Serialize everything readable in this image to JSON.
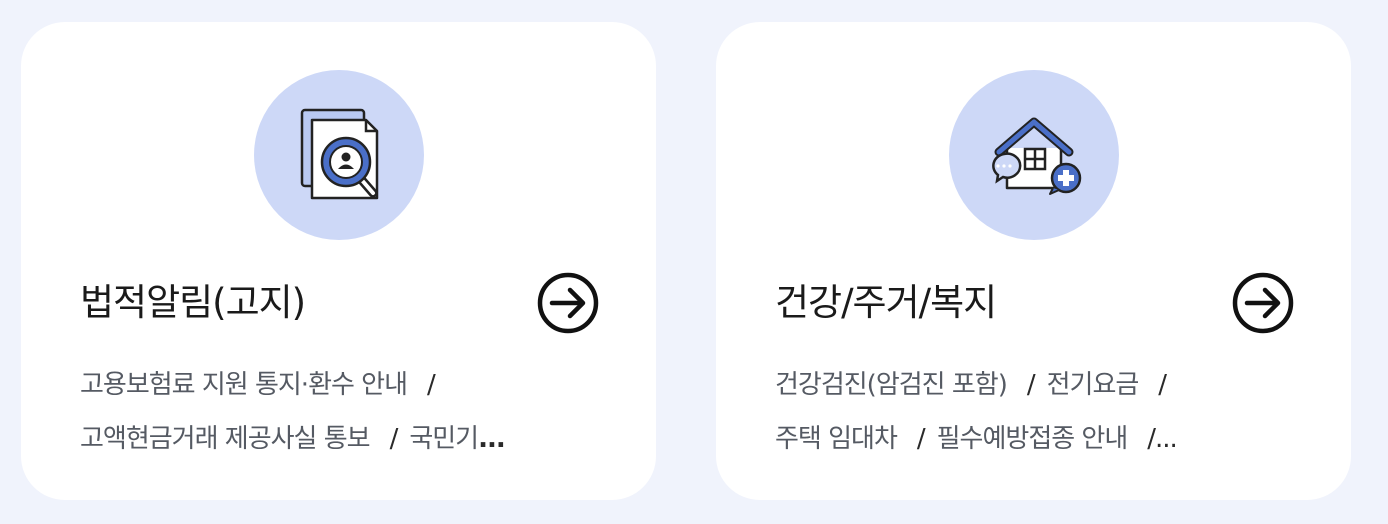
{
  "cards": [
    {
      "title": "법적알림(고지)",
      "icon": "document-search-icon",
      "lines": [
        [
          "고용보험료 지원 통지·환수 안내",
          "/"
        ],
        [
          "고액현금거래 제공사실 통보",
          "/",
          "국민기",
          "..."
        ]
      ]
    },
    {
      "title": "건강/주거/복지",
      "icon": "house-care-icon",
      "lines": [
        [
          "건강검진(암검진 포함)",
          "/",
          "전기요금",
          "/"
        ],
        [
          "주택 임대차",
          "/",
          "필수예방접종 안내",
          "/..."
        ]
      ]
    }
  ],
  "colors": {
    "background": "#f0f3fc",
    "card": "#ffffff",
    "icon_circle": "#cdd8f7",
    "accent": "#4a6fc8"
  }
}
